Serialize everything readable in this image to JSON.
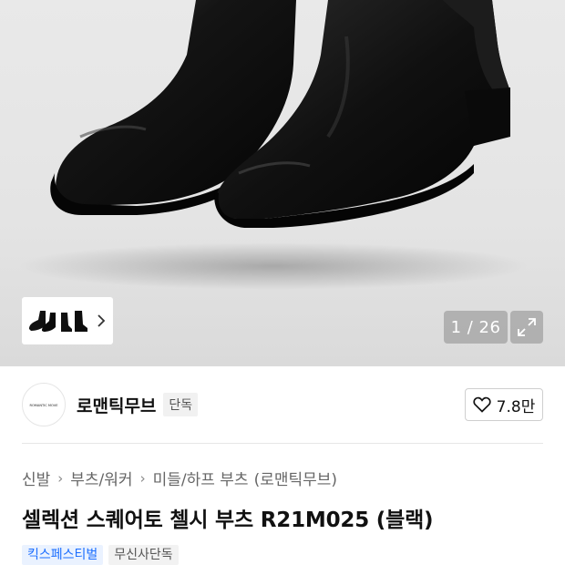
{
  "gallery": {
    "counter": "1 / 26",
    "current_index": 1,
    "total": 26,
    "thumb_icon": "boots-thumbnail",
    "next_icon": "chevron-right-icon",
    "expand_icon": "expand-icon"
  },
  "brand": {
    "logo_text": "ROMANTIC MOVE",
    "name": "로맨틱무브",
    "exclusive_badge": "단독",
    "like_count": "7.8만",
    "like_icon": "heart-outline-icon"
  },
  "breadcrumb": [
    "신발",
    "부츠/워커",
    "미들/하프 부츠",
    "(로맨틱무브)"
  ],
  "product": {
    "title": "셀렉션 스퀘어토 첼시 부츠 R21M025 (블랙)"
  },
  "tags": [
    {
      "label": "킥스페스티벌",
      "style": "blue"
    },
    {
      "label": "무신사단독",
      "style": "gray"
    }
  ],
  "colors": {
    "accent_blue": "#1a6dff",
    "hero_bg": "#e6e6e6",
    "boot_black": "#0e0e0e"
  }
}
